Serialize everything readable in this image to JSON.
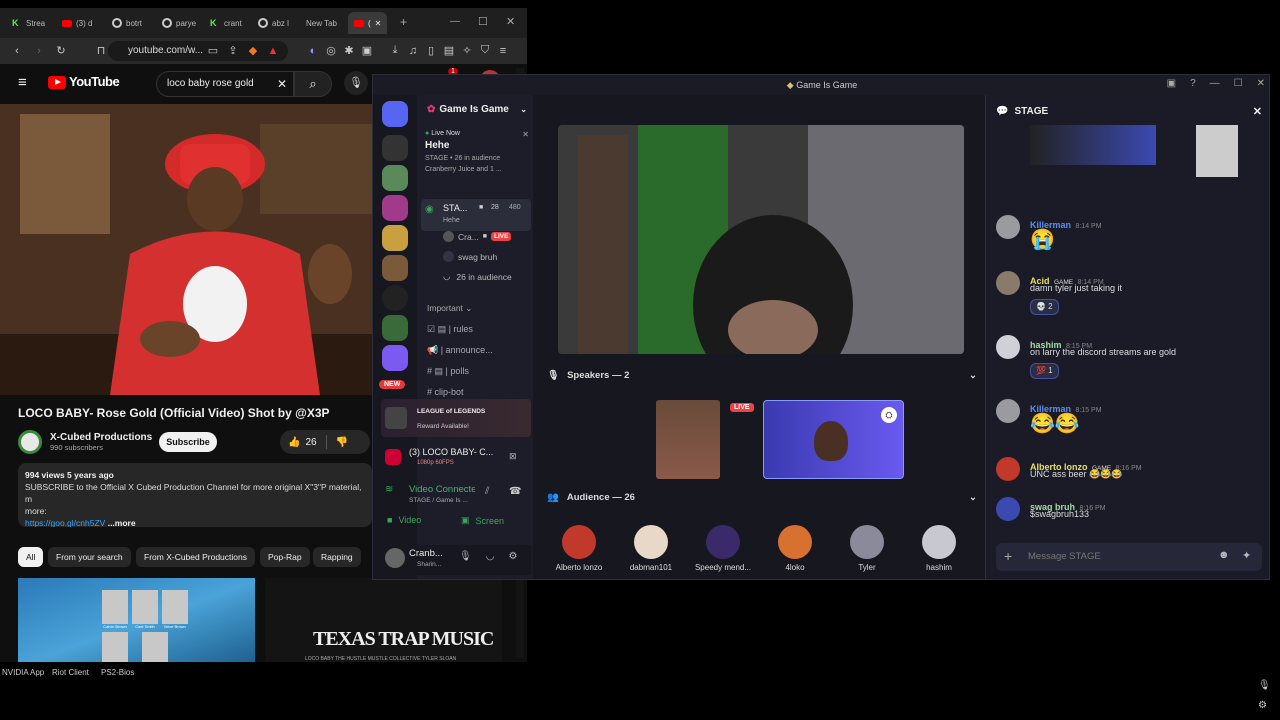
{
  "browser": {
    "tabs": [
      {
        "label": "Strea",
        "icon": "kick-icon"
      },
      {
        "label": "(3) d",
        "icon": "youtube-icon"
      },
      {
        "label": "botrt",
        "icon": "google-icon"
      },
      {
        "label": "parye",
        "icon": "google-icon"
      },
      {
        "label": "crant",
        "icon": "kick-icon"
      },
      {
        "label": "abz l",
        "icon": "google-icon"
      },
      {
        "label": "New Tab",
        "icon": "none"
      },
      {
        "label": "(",
        "icon": "youtube-icon"
      }
    ],
    "url": "youtube.com/w...",
    "notification_count": "1"
  },
  "youtube": {
    "logo": "YouTube",
    "search_value": "loco baby rose gold",
    "video_title": "LOCO BABY- Rose Gold (Official Video) Shot by @X3P",
    "channel_name": "X-Cubed Productions",
    "subscribers": "990 subscribers",
    "subscribe_label": "Subscribe",
    "likes": "26",
    "views_line": "994 views  5 years ago",
    "description": "SUBSCRIBE to the Official X Cubed Production Channel for more original X\"3\"P material, m",
    "description_more_prefix": "more:",
    "link": "https://goo.gl/cnh5ZV",
    "more_label": "...more",
    "chips": [
      "All",
      "From your search",
      "From X-Cubed Productions",
      "Pop-Rap",
      "Rapping"
    ],
    "thumb2_text": "TEXAS TRAP MUSIC",
    "thumb2_sub": "LOCO BABY  THE HUSTLE MUSTLE COLLECTIVE  TYLER SLOAN",
    "thumb1_names": [
      "Calvin Brown",
      "Cael Smith",
      "Brice Brown",
      "",
      ""
    ]
  },
  "taskbar": [
    "NVIDIA App",
    "Riot Client",
    "PS2-Bios"
  ],
  "discord": {
    "window_title": "Game Is Game",
    "server_name": "Game Is Game",
    "live_now": "Live Now",
    "stage_title": "Hehe",
    "stage_meta": "STAGE • 26 in audience",
    "stage_sub": "Cranberry Juice and 1 ...",
    "stage_channel": "STA...",
    "stage_channel_sub": "Hehe",
    "stage_count": "28",
    "stage_cap": "480",
    "members": [
      {
        "name": "Cra...",
        "live": "LIVE"
      },
      {
        "name": "swag bruh",
        "live": ""
      }
    ],
    "in_audience": "26 in audience",
    "category": "Important",
    "channels": [
      "| rules",
      "| announce...",
      "| polls",
      "clip-bot"
    ],
    "new_badge": "NEW",
    "promo_title": "LEAGUE of LEGENDS",
    "promo_sub": "Reward Available!",
    "activity_title": "(3) LOCO BABY- C...",
    "activity_sub": "1080p 60FPS",
    "voice_status": "Video Connected",
    "voice_sub": "STAGE / Game Is ...",
    "video_btn": "Video",
    "screen_btn": "Screen",
    "user_name": "Cranb...",
    "user_status": "Sharin...",
    "speakers_label": "Speakers — 2",
    "audience_label": "Audience — 26",
    "live_badge": "LIVE",
    "audience": [
      {
        "name": "Alberto lonzo",
        "color": "#c0392b"
      },
      {
        "name": "dabman101",
        "color": "#e8d8c8"
      },
      {
        "name": "Speedy mend...",
        "color": "#3a2a6a"
      },
      {
        "name": "4loko",
        "color": "#d87030"
      },
      {
        "name": "Tyler",
        "color": "#8a8a9a"
      },
      {
        "name": "hashim",
        "color": "#c8c8d0"
      }
    ],
    "chat_header": "STAGE",
    "messages": [
      {
        "name": "Killerman",
        "color": "#5b8ef0",
        "time": "8:14 PM",
        "text": "😭",
        "tag": ""
      },
      {
        "name": "Acid",
        "color": "#e8e060",
        "time": "8:14 PM",
        "text": "damn tyler just taking it",
        "tag": "GAME",
        "reaction": "💀 2"
      },
      {
        "name": "hashim",
        "color": "#9ee09e",
        "time": "8:15 PM",
        "text": "on larry the discord streams are gold",
        "tag": "",
        "reaction": "💯 1"
      },
      {
        "name": "Killerman",
        "color": "#5b8ef0",
        "time": "8:15 PM",
        "text": "😂😂",
        "tag": ""
      },
      {
        "name": "Alberto lonzo",
        "color": "#e8e060",
        "time": "8:16 PM",
        "text": "UNC ass beer 😂😂😂",
        "tag": "GAME"
      },
      {
        "name": "swag bruh",
        "color": "#9ee09e",
        "time": "8:16 PM",
        "text": "$swagbruh133",
        "tag": ""
      }
    ],
    "message_placeholder": "Message STAGE"
  }
}
